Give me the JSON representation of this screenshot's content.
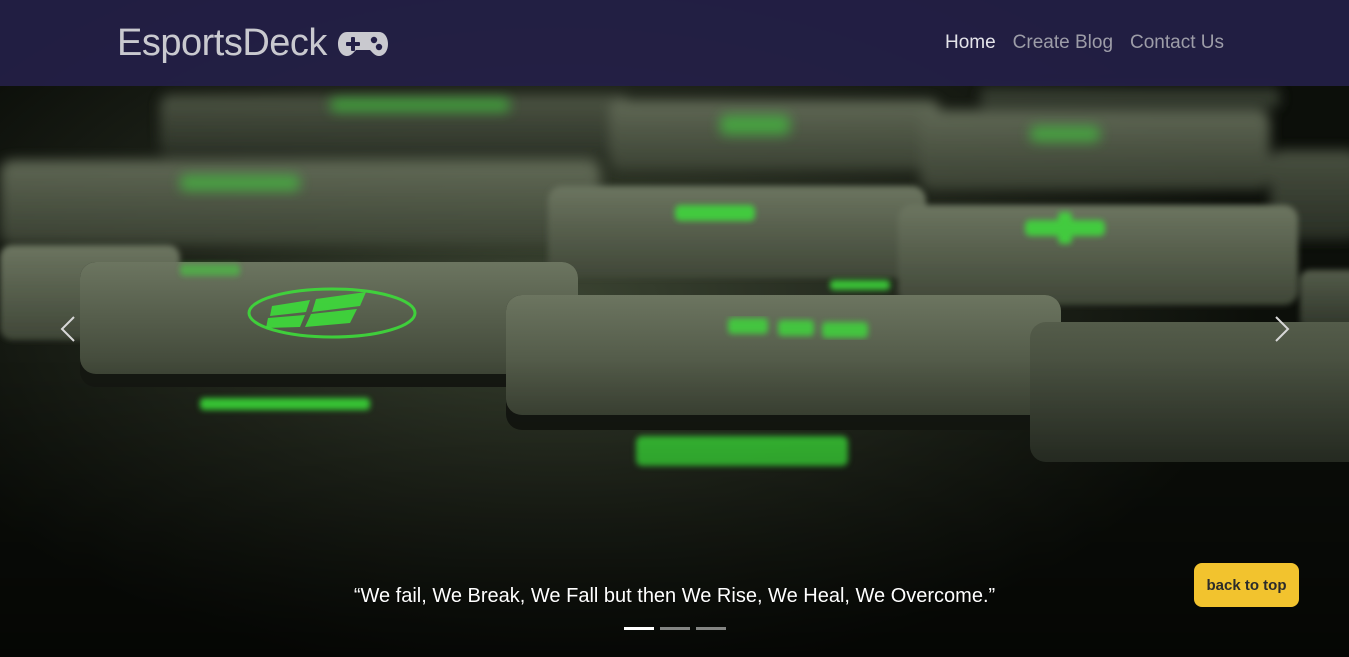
{
  "brand": {
    "name": "EsportsDeck",
    "icon": "gamepad-icon"
  },
  "nav": {
    "links": [
      {
        "label": "Home",
        "active": true
      },
      {
        "label": "Create Blog",
        "active": false
      },
      {
        "label": "Contact Us",
        "active": false
      }
    ]
  },
  "carousel": {
    "image": "green-backlit-keyboard-closeup",
    "caption": "“We fail, We Break, We Fall but then We Rise, We Heal, We Overcome.”",
    "prev_icon": "chevron-left-icon",
    "next_icon": "chevron-right-icon",
    "slide_count": 3,
    "active_slide": 1
  },
  "back_to_top": {
    "label": "back to top"
  },
  "colors": {
    "navbar": "#242048",
    "accent_button": "#f2c32e",
    "key_glow": "#3ddc3a"
  }
}
